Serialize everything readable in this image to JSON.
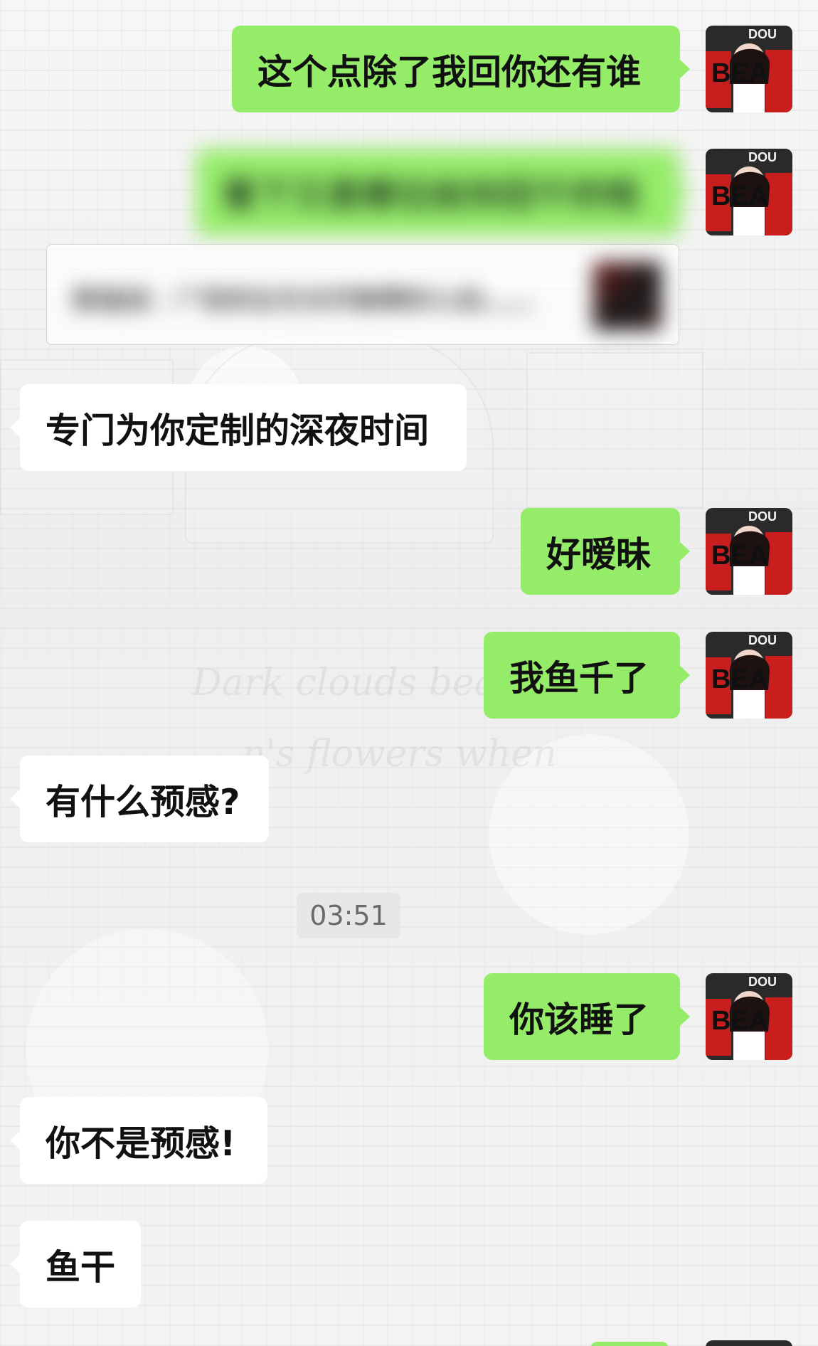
{
  "chat": {
    "messages": [
      {
        "id": "m1",
        "side": "me",
        "text": "这个点除了我回你还有谁"
      },
      {
        "id": "m2",
        "side": "me",
        "text": "看下又是哪位给你回千的啦",
        "blurred": true
      },
      {
        "id": "m2_quote",
        "text": "那谁说：广告的女生也可能帮好心动……",
        "blurred": true
      },
      {
        "id": "m3",
        "side": "them",
        "text": "专门为你定制的深夜时间"
      },
      {
        "id": "m4",
        "side": "me",
        "text": "好暧昧"
      },
      {
        "id": "m5",
        "side": "me",
        "text": "我鱼千了"
      },
      {
        "id": "m6",
        "side": "them",
        "text": "有什么预感?"
      },
      {
        "id": "m7",
        "side": "me",
        "text": "你该睡了"
      },
      {
        "id": "m8",
        "side": "them",
        "text": "你不是预感!"
      },
      {
        "id": "m9",
        "side": "them",
        "text": "鱼干"
      }
    ],
    "timestamp": "03:51"
  },
  "background_text": {
    "line1": "Dark clouds bea",
    "line2": "n's flowers when"
  },
  "avatar": {
    "letters": "BEA",
    "topText": "DOU"
  },
  "colors": {
    "me_bubble": "#95ec69",
    "them_bubble": "#ffffff",
    "background": "#ededed",
    "timestamp_bg": "#e6e6e6"
  }
}
